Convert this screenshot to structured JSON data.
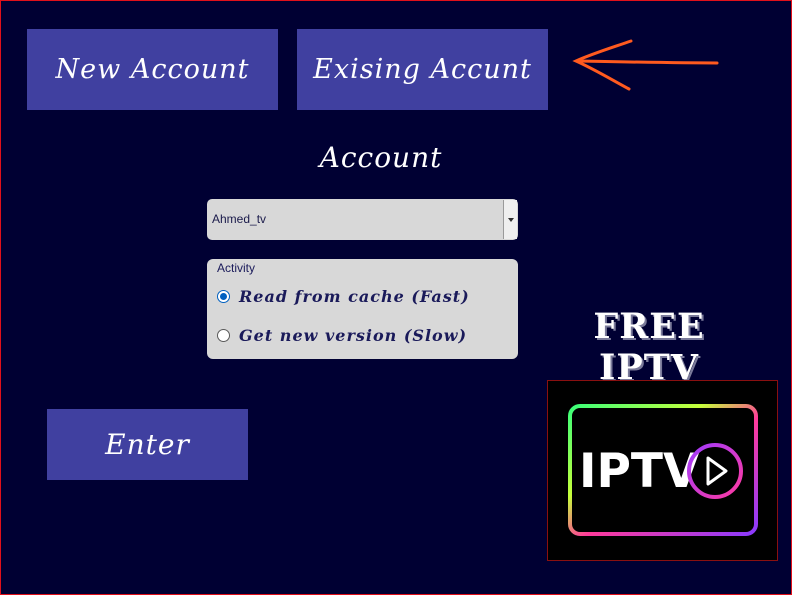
{
  "buttons": {
    "new_account": "New Account",
    "existing_account": "Exising Accunt",
    "enter": "Enter"
  },
  "account_heading": "Account",
  "account_combo": {
    "selected": "Ahmed_tv"
  },
  "activity": {
    "label": "Activity",
    "options": [
      {
        "label": "Read from cache (Fast)",
        "checked": true
      },
      {
        "label": "Get new version (Slow)",
        "checked": false
      }
    ]
  },
  "promo": {
    "title": "FREE IPTV"
  },
  "logo": {
    "text": "IPTV"
  },
  "colors": {
    "background": "#000033",
    "button": "#4040a0",
    "arrow": "#ff5a1f",
    "frame_border": "#e0101a"
  },
  "icons": [
    "arrow-left-icon",
    "dropdown-arrow-icon",
    "play-icon"
  ]
}
